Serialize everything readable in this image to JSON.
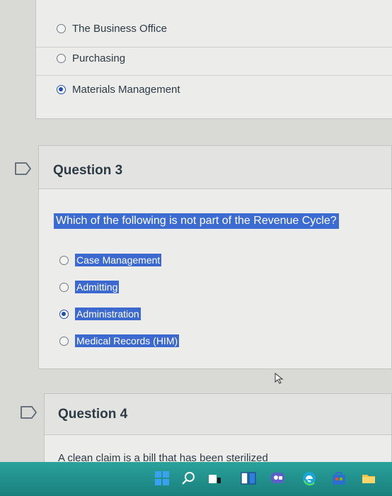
{
  "previous_question": {
    "options": [
      {
        "label": "The Business Office",
        "selected": false
      },
      {
        "label": "Purchasing",
        "selected": false
      },
      {
        "label": "Materials Management",
        "selected": true
      }
    ]
  },
  "question3": {
    "title": "Question 3",
    "prompt": "Which of the following is not part of the Revenue Cycle?",
    "options": [
      {
        "label": "Case Management",
        "selected": false
      },
      {
        "label": "Admitting",
        "selected": false
      },
      {
        "label": "Administration",
        "selected": true
      },
      {
        "label": "Medical Records (HIM)",
        "selected": false
      }
    ]
  },
  "question4": {
    "title": "Question 4",
    "prompt_partial": "A clean claim is a bill that has been sterilized"
  },
  "colors": {
    "highlight": "#3b69cf",
    "selected_radio": "#1f4fb3",
    "taskbar": "#1d8a86"
  },
  "taskbar_icons": [
    "windows-start-icon",
    "search-icon",
    "task-view-icon",
    "widgets-icon",
    "chat-icon",
    "edge-browser-icon",
    "store-icon",
    "file-explorer-icon"
  ]
}
